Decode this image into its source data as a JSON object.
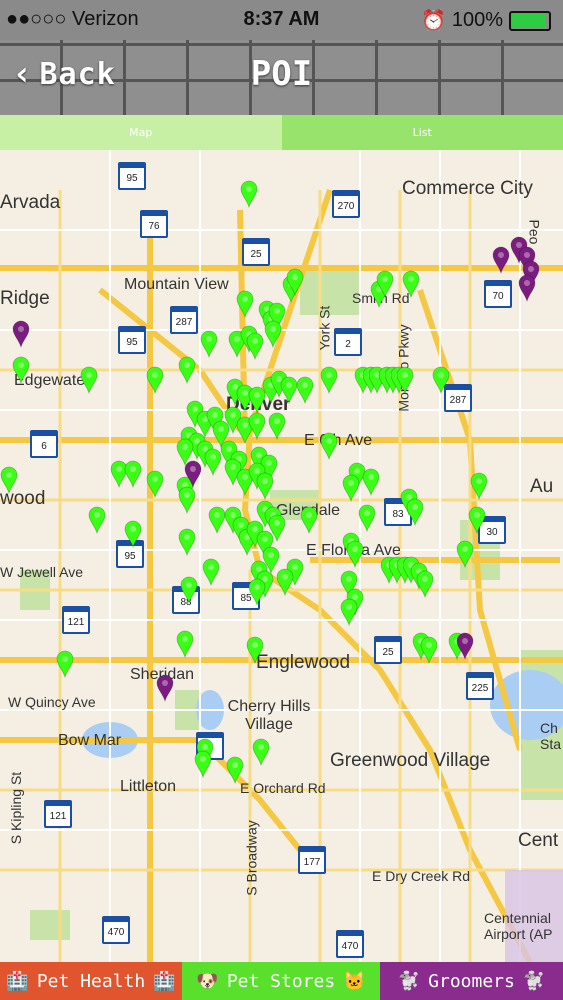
{
  "status_bar": {
    "carrier": "●●○○○ Verizon",
    "time": "8:37 AM",
    "battery": "100%",
    "battery_level": 1.0
  },
  "navbar": {
    "back_label": "Back",
    "title": "POI"
  },
  "tabs": [
    {
      "label": "Map"
    },
    {
      "label": "List"
    }
  ],
  "map": {
    "labels": {
      "arvada": "Arvada",
      "commerce_city": "Commerce City",
      "ridge": "Ridge",
      "mountain_view": "Mountain View",
      "edgewater": "Edgewater",
      "denver": "Denver",
      "york_st": "York St",
      "monaco_pkwy": "Monaco Pkwy",
      "e_6th_ave": "E 6th Ave",
      "wood": "wood",
      "glendale": "Glendale",
      "e_florida_ave": "E Florida Ave",
      "w_jewell_ave": "W Jewell Ave",
      "englewood": "Englewood",
      "sheridan": "Sheridan",
      "w_quincy_ave": "W Quincy Ave",
      "cherry_hills_village": "Cherry Hills Village",
      "bow_mar": "Bow Mar",
      "littleton": "Littleton",
      "e_orchard_rd": "E Orchard Rd",
      "greenwood_village": "Greenwood Village",
      "s_broadway": "S Broadway",
      "s_kipling_st": "S Kipling St",
      "e_dry_creek_rd": "E Dry Creek Rd",
      "centennial_airport": "Centennial Airport (AP",
      "au": "Au",
      "ch_sta": "Ch Sta",
      "cent": "Cent",
      "peoria": "Peo",
      "smith_rd": "Smith Rd"
    },
    "shields": {
      "i95a": "95",
      "i76": "76",
      "i270": "270",
      "i25a": "25",
      "i70": "70",
      "i287a": "287",
      "i95b": "95",
      "i2": "2",
      "i287b": "287",
      "i6": "6",
      "i83": "83",
      "i30": "30",
      "i95c": "95",
      "i88": "88",
      "i85": "85",
      "i121a": "121",
      "i25b": "25",
      "i225": "225",
      "i8": "8",
      "i121b": "121",
      "i177": "177",
      "i470a": "470",
      "i470b": "470"
    },
    "colors": {
      "store_marker": "#39ff14",
      "groomer_marker": "#7b1d7e",
      "road": "#f4c842",
      "park": "#c8e3a8",
      "water": "#a9cdf3"
    }
  },
  "bottom_tabs": {
    "health": {
      "label": "Pet Health",
      "icon_left": "🏥",
      "icon_right": "🏥"
    },
    "stores": {
      "label": "Pet Stores",
      "icon_left": "🐶",
      "icon_right": "🐱"
    },
    "groomers": {
      "label": "Groomers",
      "icon_left": "🐩",
      "icon_right": "🐩"
    }
  }
}
